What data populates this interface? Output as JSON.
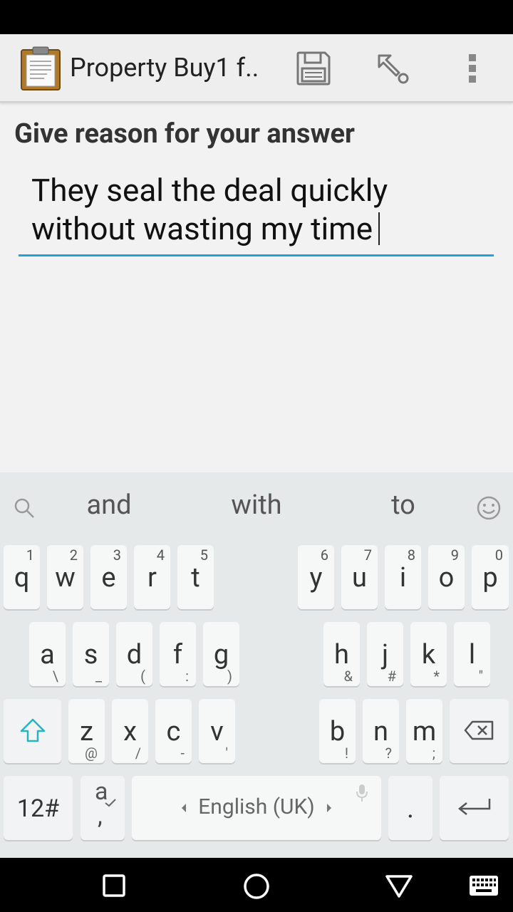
{
  "app_bar": {
    "title": "Property Buy1 f..",
    "icons": [
      "clipboard-icon",
      "save-icon",
      "go-to-icon",
      "more-icon"
    ]
  },
  "form": {
    "question": "Give reason for your answer",
    "answer_line1": "They seal the deal quickly",
    "answer_line2": "without wasting my time",
    "accent_color": "#1ea3d5"
  },
  "keyboard": {
    "suggestions": [
      "and",
      "with",
      "to"
    ],
    "row1": [
      {
        "key": "q",
        "num": "1"
      },
      {
        "key": "w",
        "num": "2"
      },
      {
        "key": "e",
        "num": "3"
      },
      {
        "key": "r",
        "num": "4"
      },
      {
        "key": "t",
        "num": "5"
      },
      {
        "key": "y",
        "num": "6"
      },
      {
        "key": "u",
        "num": "7"
      },
      {
        "key": "i",
        "num": "8"
      },
      {
        "key": "o",
        "num": "9"
      },
      {
        "key": "p",
        "num": "0"
      }
    ],
    "row2": [
      {
        "key": "a",
        "sub": "\\"
      },
      {
        "key": "s",
        "sub": "_"
      },
      {
        "key": "d",
        "sub": "("
      },
      {
        "key": "f",
        "sub": ":"
      },
      {
        "key": "g",
        "sub": ")"
      },
      {
        "key": "h",
        "sub": "&"
      },
      {
        "key": "j",
        "sub": "#"
      },
      {
        "key": "k",
        "sub": "*"
      },
      {
        "key": "l",
        "sub": "\""
      }
    ],
    "row3": [
      {
        "key": "z",
        "sub": "@"
      },
      {
        "key": "x",
        "sub": "/"
      },
      {
        "key": "c",
        "sub": "-"
      },
      {
        "key": "v",
        "sub": "'"
      },
      {
        "key": "b",
        "sub": "!"
      },
      {
        "key": "n",
        "sub": "?"
      },
      {
        "key": "m",
        "sub": ";"
      }
    ],
    "symbols_label": "12#",
    "lang_key_top": "a",
    "lang_key_bottom": ",",
    "space_label": "English (UK)",
    "period_label": "."
  }
}
